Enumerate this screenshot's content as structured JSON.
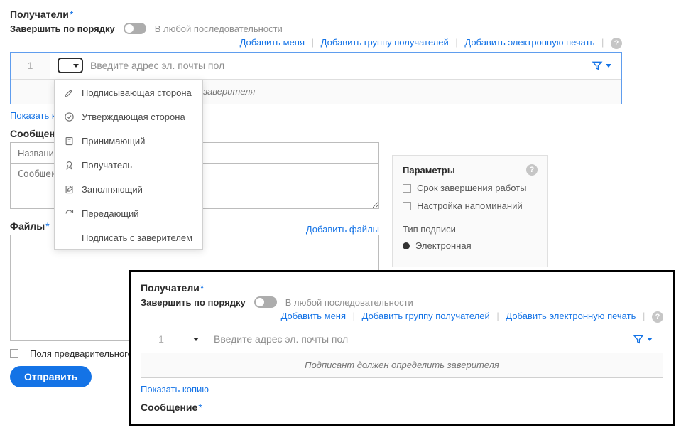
{
  "main": {
    "recipients_title": "Получатели",
    "order_label": "Завершить по порядку",
    "any_order_label": "В любой последовательности",
    "links": {
      "add_me": "Добавить меня",
      "add_group": "Добавить группу получателей",
      "add_seal": "Добавить электронную печать"
    },
    "recipient_row": {
      "number": "1",
      "email_placeholder": "Введите адрес эл. почты пол"
    },
    "notary_note": "ределить заверителя",
    "show_copy": "Показать ко",
    "message_title": "Сообщени",
    "name_placeholder": "Названи",
    "msg_placeholder": "Сообщен",
    "files_title": "Файлы",
    "add_files": "Добавить файлы",
    "prefill_label": "Поля предварительного п",
    "send_btn": "Отправить"
  },
  "dropdown": {
    "items": [
      {
        "icon": "pen-nib-icon",
        "label": "Подписывающая сторона"
      },
      {
        "icon": "check-circle-icon",
        "label": "Утверждающая сторона"
      },
      {
        "icon": "inbox-icon",
        "label": "Принимающий"
      },
      {
        "icon": "ribbon-icon",
        "label": "Получатель"
      },
      {
        "icon": "edit-icon",
        "label": "Заполняющий"
      },
      {
        "icon": "arrow-redo-icon",
        "label": "Передающий"
      },
      {
        "icon": "blank-icon",
        "label": "Подписать с заверителем"
      }
    ]
  },
  "params": {
    "title": "Параметры",
    "deadline": "Срок завершения работы",
    "reminders": "Настройка напоминаний",
    "sig_type_title": "Тип подписи",
    "sig_type_electronic": "Электронная"
  },
  "inset": {
    "recipients_title": "Получатели",
    "order_label": "Завершить по порядку",
    "any_order_label": "В любой последовательности",
    "links": {
      "add_me": "Добавить меня",
      "add_group": "Добавить группу получателей",
      "add_seal": "Добавить электронную печать"
    },
    "recipient_row": {
      "number": "1",
      "email_placeholder": "Введите адрес эл. почты пол"
    },
    "notary_note": "Подписант должен определить заверителя",
    "show_copy": "Показать копию",
    "message_title": "Сообщение"
  }
}
